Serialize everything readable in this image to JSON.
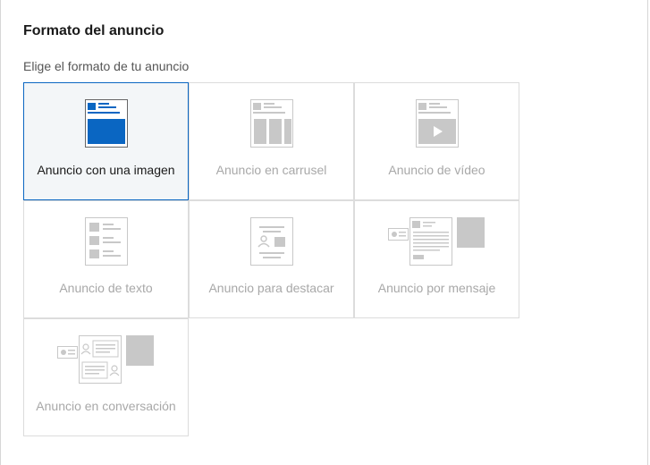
{
  "section": {
    "title": "Formato del anuncio",
    "subtitle": "Elige el formato de tu anuncio"
  },
  "formats": [
    {
      "label": "Anuncio con una imagen",
      "icon": "single-image-ad-icon",
      "selected": true
    },
    {
      "label": "Anuncio en carrusel",
      "icon": "carousel-ad-icon",
      "selected": false
    },
    {
      "label": "Anuncio de vídeo",
      "icon": "video-ad-icon",
      "selected": false
    },
    {
      "label": "Anuncio de texto",
      "icon": "text-ad-icon",
      "selected": false
    },
    {
      "label": "Anuncio para destacar",
      "icon": "spotlight-ad-icon",
      "selected": false
    },
    {
      "label": "Anuncio por mensaje",
      "icon": "message-ad-icon",
      "selected": false
    },
    {
      "label": "Anuncio en conversación",
      "icon": "conversation-ad-icon",
      "selected": false
    }
  ],
  "colors": {
    "accent": "#0a66c2",
    "selected_bg": "#f3f6f8",
    "muted_art": "#c8c8c8",
    "muted_text": "#a8a8a8"
  }
}
